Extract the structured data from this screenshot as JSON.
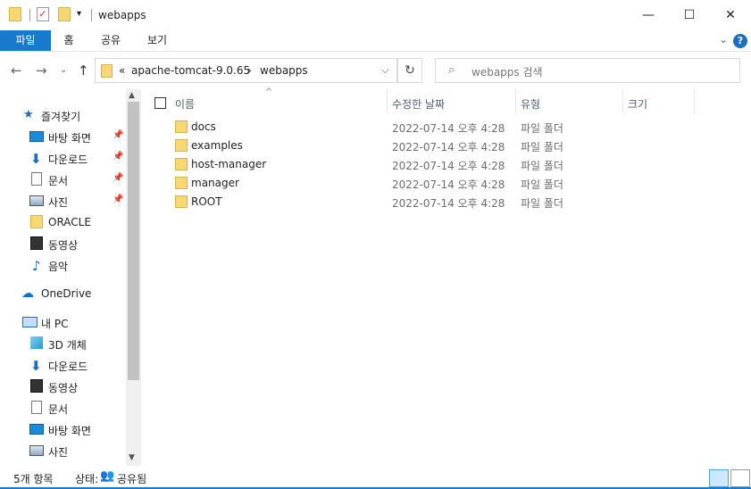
{
  "window": {
    "title": "webapps",
    "minimize_glyph": "—",
    "maximize_glyph": "☐",
    "close_glyph": "✕"
  },
  "ribbon": {
    "tabs": [
      "파일",
      "홈",
      "공유",
      "보기"
    ]
  },
  "address": {
    "overflow": "«",
    "segments": [
      "apache-tomcat-9.0.65",
      "webapps"
    ],
    "separator": "›",
    "search_placeholder": "webapps 검색"
  },
  "nav": {
    "quick_access": "즐겨찾기",
    "quick_items": [
      {
        "label": "바탕 화면",
        "icon": "desktop-icon",
        "pinned": true
      },
      {
        "label": "다운로드",
        "icon": "download-icon",
        "pinned": true
      },
      {
        "label": "문서",
        "icon": "document-icon",
        "pinned": true
      },
      {
        "label": "사진",
        "icon": "picture-icon",
        "pinned": true
      },
      {
        "label": "ORACLE",
        "icon": "folder-icon",
        "pinned": false
      },
      {
        "label": "동영상",
        "icon": "video-icon",
        "pinned": false
      },
      {
        "label": "음악",
        "icon": "music-icon",
        "pinned": false
      }
    ],
    "onedrive": "OneDrive",
    "thispc": "내 PC",
    "pc_items": [
      {
        "label": "3D 개체",
        "icon": "3d-objects-icon"
      },
      {
        "label": "다운로드",
        "icon": "download-icon"
      },
      {
        "label": "동영상",
        "icon": "video-icon"
      },
      {
        "label": "문서",
        "icon": "document-icon"
      },
      {
        "label": "바탕 화면",
        "icon": "desktop-icon"
      },
      {
        "label": "사진",
        "icon": "picture-icon"
      }
    ]
  },
  "columns": {
    "name": "이름",
    "modified": "수정한 날짜",
    "type": "유형",
    "size": "크기"
  },
  "files": [
    {
      "name": "docs",
      "modified": "2022-07-14 오후 4:28",
      "type": "파일 폴더"
    },
    {
      "name": "examples",
      "modified": "2022-07-14 오후 4:28",
      "type": "파일 폴더"
    },
    {
      "name": "host-manager",
      "modified": "2022-07-14 오후 4:28",
      "type": "파일 폴더"
    },
    {
      "name": "manager",
      "modified": "2022-07-14 오후 4:28",
      "type": "파일 폴더"
    },
    {
      "name": "ROOT",
      "modified": "2022-07-14 오후 4:28",
      "type": "파일 폴더"
    }
  ],
  "status": {
    "count": "5개 항목",
    "state_label": "상태:",
    "state_value": "공유됨"
  },
  "colors": {
    "accent": "#1979ca",
    "folder": "#f8d775"
  }
}
